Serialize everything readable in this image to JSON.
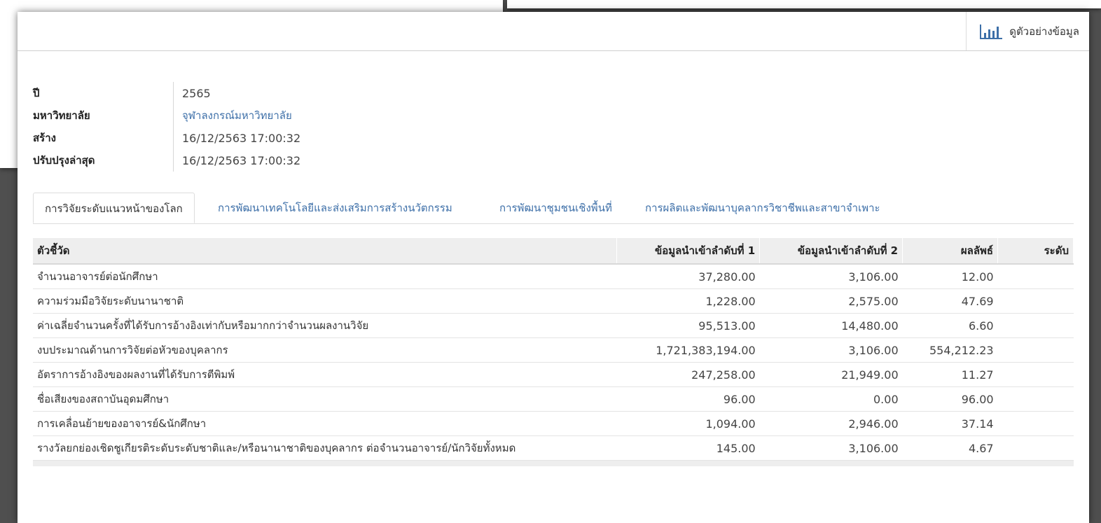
{
  "header": {
    "preview_label": "ดูตัวอย่างข้อมูล",
    "preview_icon": "bar-chart-icon"
  },
  "info": {
    "year_label": "ปี",
    "year_value": "2565",
    "university_label": "มหาวิทยาลัย",
    "university_value": "จุฬาลงกรณ์มหาวิทยาลัย",
    "created_label": "สร้าง",
    "created_value": "16/12/2563 17:00:32",
    "updated_label": "ปรับปรุงล่าสุด",
    "updated_value": "16/12/2563 17:00:32"
  },
  "tabs": [
    {
      "label": "การวิจัยระดับแนวหน้าของโลก",
      "active": true
    },
    {
      "label": "การพัฒนาเทคโนโลยีและส่งเสริมการสร้างนวัตกรรม",
      "active": false
    },
    {
      "label": "การพัฒนาชุมชนเชิงพื้นที่",
      "active": false
    },
    {
      "label": "การผลิตและพัฒนาบุคลากรวิชาชีพและสาขาจำเพาะ",
      "active": false
    }
  ],
  "table": {
    "columns": [
      "ตัวชี้วัด",
      "ข้อมูลนำเข้าลำดับที่ 1",
      "ข้อมูลนำเข้าลำดับที่ 2",
      "ผลลัพธ์",
      "ระดับ"
    ],
    "rows": [
      {
        "indicator": "จำนวนอาจารย์ต่อนักศึกษา",
        "input1": "37,280.00",
        "input2": "3,106.00",
        "result": "12.00",
        "level": ""
      },
      {
        "indicator": "ความร่วมมือวิจัยระดับนานาชาติ",
        "input1": "1,228.00",
        "input2": "2,575.00",
        "result": "47.69",
        "level": ""
      },
      {
        "indicator": "ค่าเฉลี่ยจำนวนครั้งที่ได้รับการอ้างอิงเท่ากับหรือมากกว่าจำนวนผลงานวิจัย",
        "input1": "95,513.00",
        "input2": "14,480.00",
        "result": "6.60",
        "level": ""
      },
      {
        "indicator": "งบประมาณด้านการวิจัยต่อหัวของบุคลากร",
        "input1": "1,721,383,194.00",
        "input2": "3,106.00",
        "result": "554,212.23",
        "level": ""
      },
      {
        "indicator": "อัตราการอ้างอิงของผลงานที่ได้รับการตีพิมพ์",
        "input1": "247,258.00",
        "input2": "21,949.00",
        "result": "11.27",
        "level": ""
      },
      {
        "indicator": "ชื่อเสียงของสถาบันอุดมศึกษา",
        "input1": "96.00",
        "input2": "0.00",
        "result": "96.00",
        "level": ""
      },
      {
        "indicator": "การเคลื่อนย้ายของอาจารย์&นักศึกษา",
        "input1": "1,094.00",
        "input2": "2,946.00",
        "result": "37.14",
        "level": ""
      },
      {
        "indicator": "รางวัลยกย่องเชิดชูเกียรติระดับระดับชาติและ/หรือนานาชาติของบุคลากร ต่อจำนวนอาจารย์/นักวิจัยทั้งหมด",
        "input1": "145.00",
        "input2": "3,106.00",
        "result": "4.67",
        "level": ""
      }
    ]
  },
  "colors": {
    "link": "#3d6fa8",
    "header_bg": "#eeeeee",
    "backdrop": "#4f4f4f"
  }
}
